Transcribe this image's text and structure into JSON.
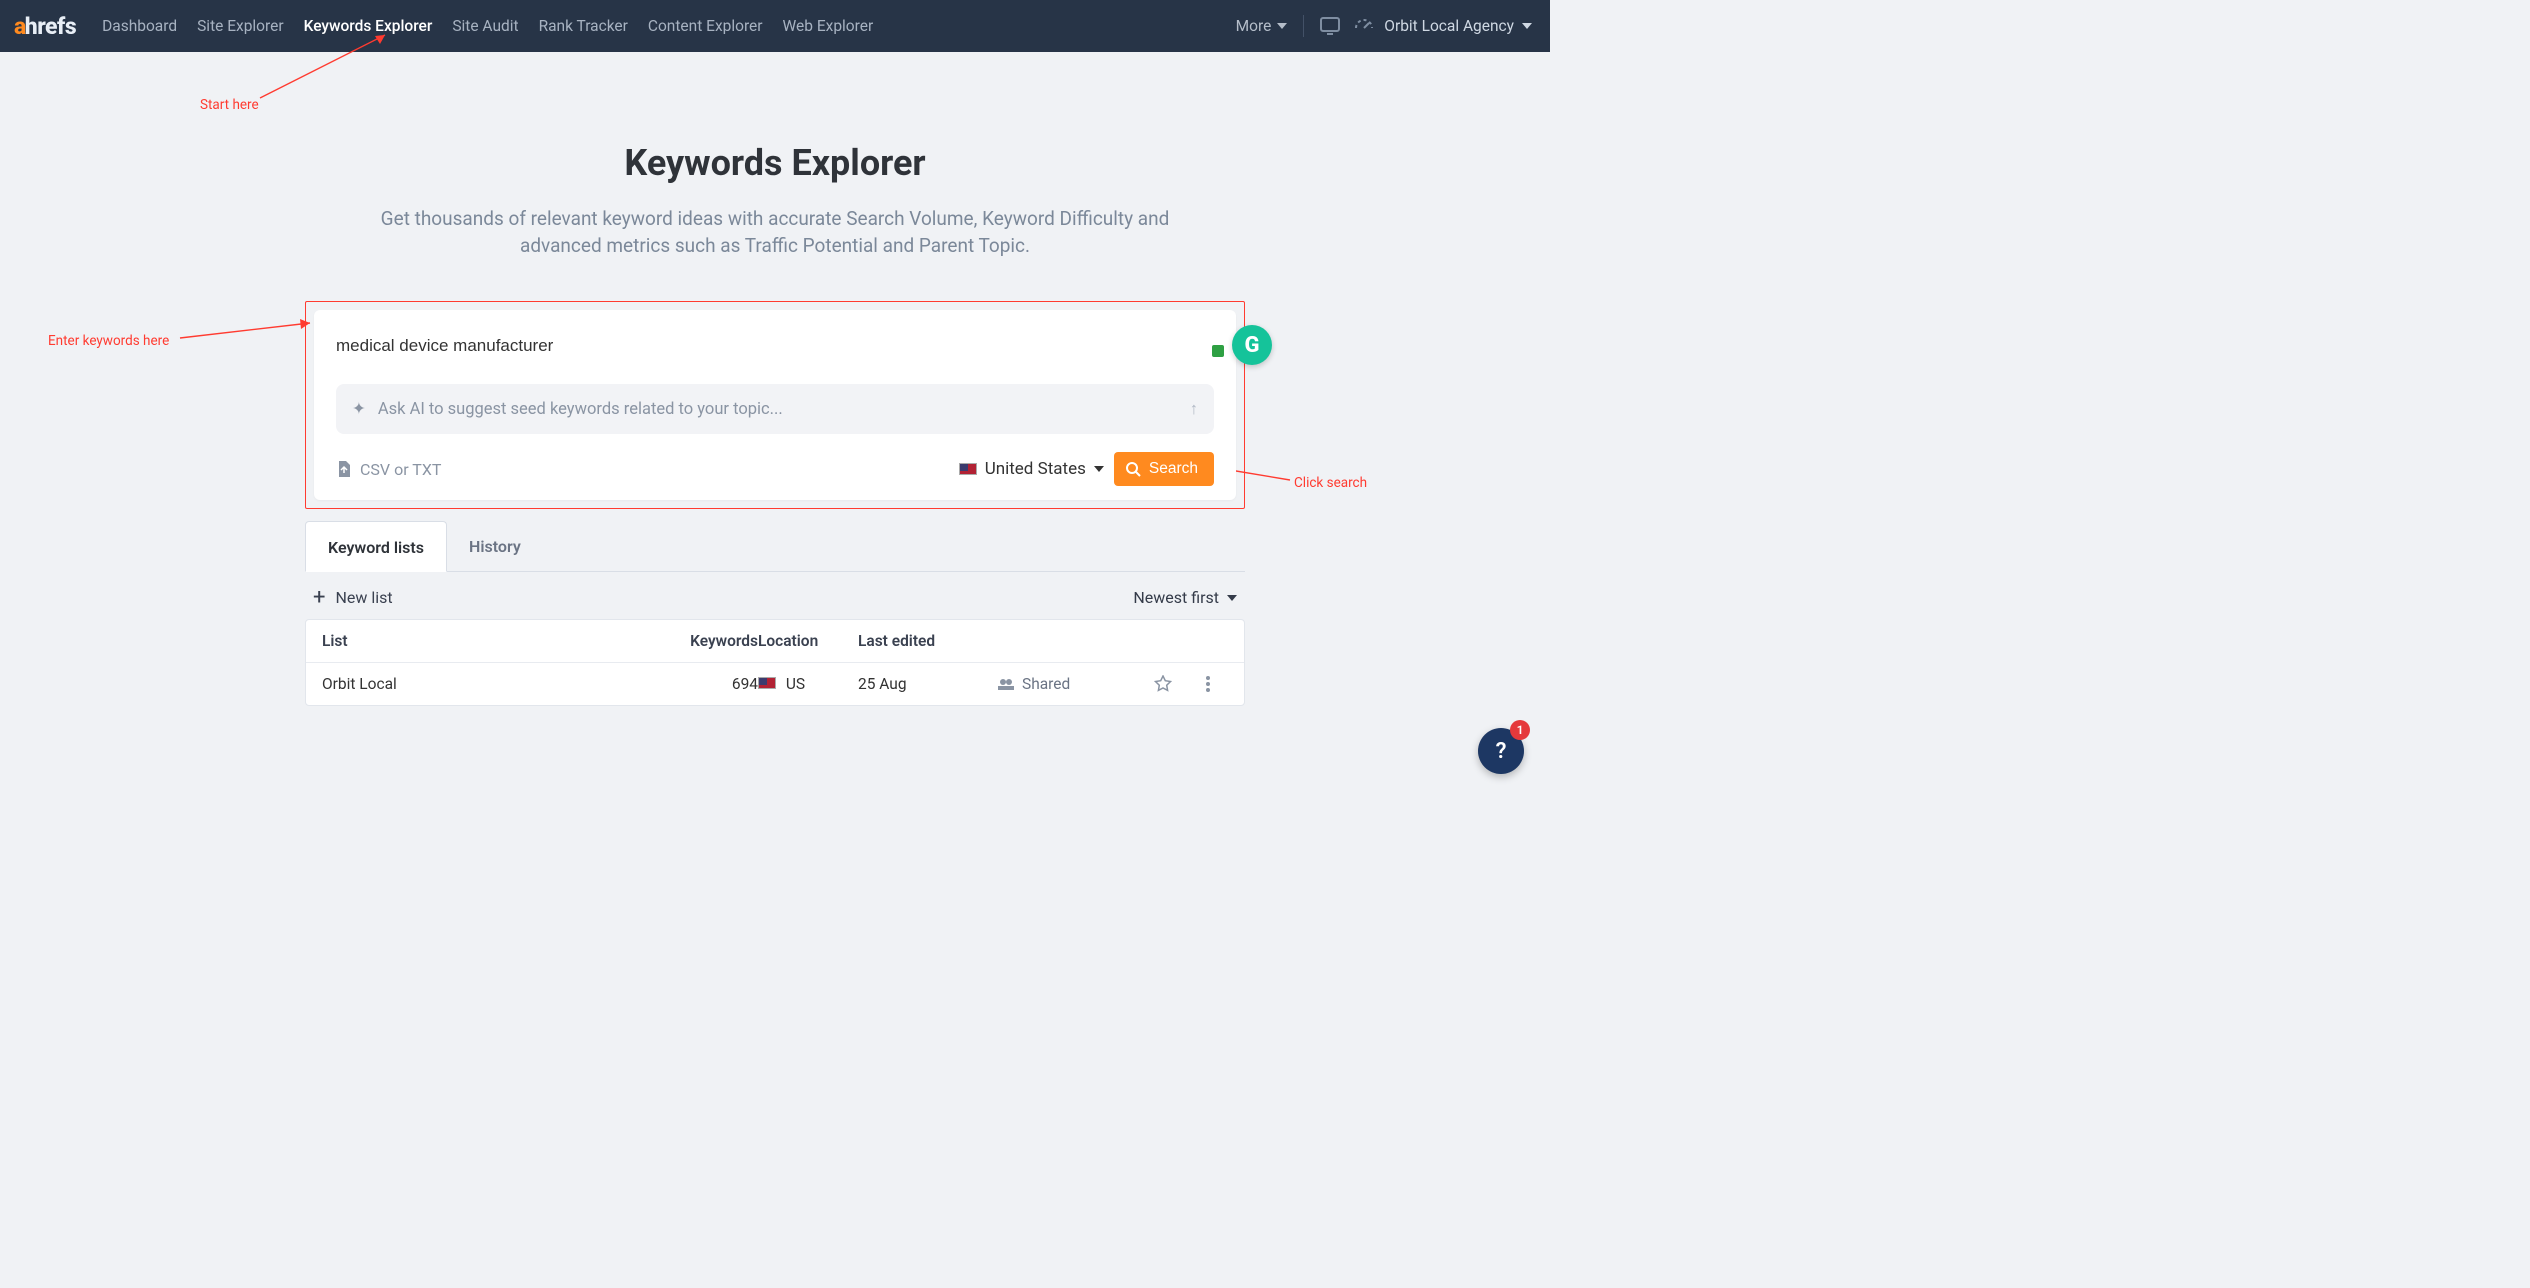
{
  "nav": {
    "items": [
      {
        "label": "Dashboard"
      },
      {
        "label": "Site Explorer"
      },
      {
        "label": "Keywords Explorer",
        "active": true
      },
      {
        "label": "Site Audit"
      },
      {
        "label": "Rank Tracker"
      },
      {
        "label": "Content Explorer"
      },
      {
        "label": "Web Explorer"
      }
    ],
    "more": "More",
    "account": "Orbit Local Agency"
  },
  "header": {
    "title": "Keywords Explorer",
    "subtitle1": "Get thousands of relevant keyword ideas with accurate Search Volume, Keyword Difficulty and",
    "subtitle2": "advanced metrics such as Traffic Potential and Parent Topic."
  },
  "panel": {
    "keyword_value": "medical device manufacturer",
    "ai_placeholder": "Ask AI to suggest seed keywords related to your topic...",
    "ai_sparkle": "✦",
    "ai_arrow": "↑",
    "csv_label": "CSV or TXT",
    "country_label": "United States",
    "search_label": "Search"
  },
  "tabs": {
    "keyword_lists": "Keyword lists",
    "history": "History"
  },
  "listbar": {
    "new_list": "New list",
    "sort": "Newest first"
  },
  "table": {
    "headers": {
      "list": "List",
      "keywords": "Keywords",
      "location": "Location",
      "last_edited": "Last edited"
    },
    "rows": [
      {
        "name": "Orbit Local",
        "keywords": "694",
        "location": "US",
        "last_edited": "25 Aug",
        "shared": "Shared"
      }
    ]
  },
  "annotations": {
    "start_here": "Start here",
    "enter_keywords": "Enter keywords here",
    "click_search": "Click search"
  },
  "help": {
    "count": "1",
    "glyph": "?"
  },
  "grammarly_glyph": "G"
}
